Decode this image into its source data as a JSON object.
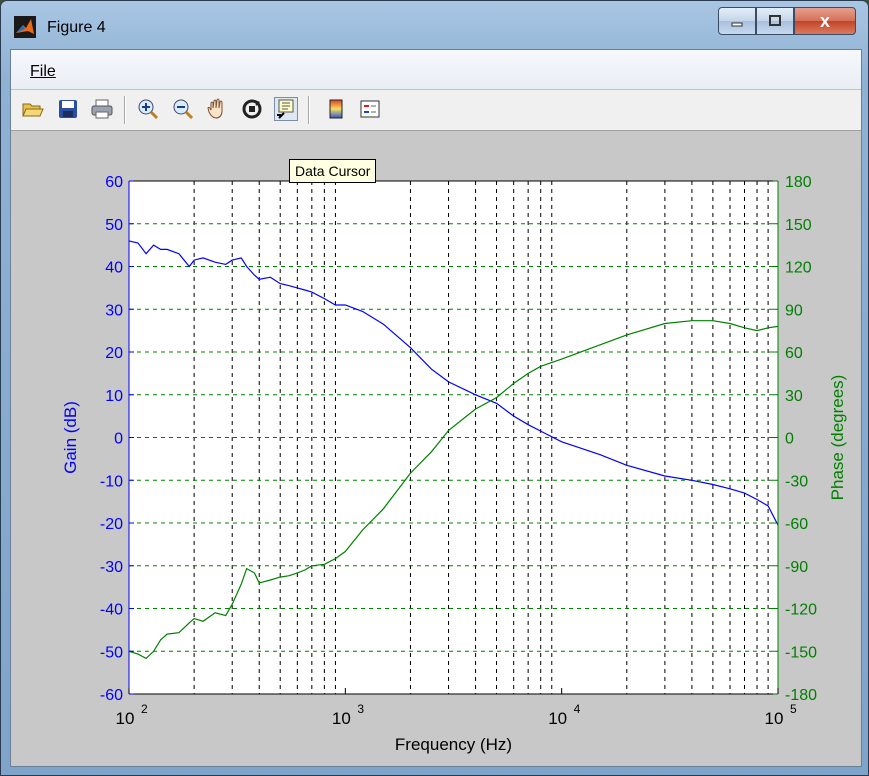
{
  "window": {
    "title": "Figure 4",
    "caption_close": "x"
  },
  "menu": {
    "file": "File"
  },
  "toolbar": {
    "icons": [
      "open-icon",
      "save-icon",
      "print-icon",
      "zoom-in-icon",
      "zoom-out-icon",
      "pan-hand-icon",
      "rotate-3d-icon",
      "data-cursor-icon",
      "colorbar-icon",
      "legend-icon"
    ],
    "active": "data-cursor-icon"
  },
  "tooltip": {
    "text": "Data Cursor"
  },
  "colors": {
    "left_axis": "#0000ff",
    "right_axis": "#008000",
    "grid_x": "#000000",
    "grid_y": "#008000"
  },
  "chart_data": {
    "type": "line",
    "xlabel": "Frequency (Hz)",
    "ylabel_left": "Gain (dB)",
    "ylabel_right": "Phase (degrees)",
    "xscale": "log",
    "xlim": [
      100,
      100000
    ],
    "x_ticks": [
      {
        "base": "10",
        "exp": "2"
      },
      {
        "base": "10",
        "exp": "3"
      },
      {
        "base": "10",
        "exp": "4"
      },
      {
        "base": "10",
        "exp": "5"
      }
    ],
    "ylim_left": [
      -60,
      60
    ],
    "y_ticks_left": [
      "60",
      "50",
      "40",
      "30",
      "20",
      "10",
      "0",
      "-10",
      "-20",
      "-30",
      "-40",
      "-50",
      "-60"
    ],
    "ylim_right": [
      -180,
      180
    ],
    "y_ticks_right": [
      "180",
      "150",
      "120",
      "90",
      "60",
      "30",
      "0",
      "-30",
      "-60",
      "-90",
      "-120",
      "-150",
      "-180"
    ],
    "grid": true,
    "series": [
      {
        "axis": "left",
        "color": "#0000ff",
        "x": [
          100,
          110,
          120,
          130,
          140,
          150,
          170,
          190,
          200,
          220,
          250,
          280,
          300,
          330,
          350,
          380,
          400,
          450,
          500,
          550,
          600,
          650,
          700,
          800,
          900,
          1000,
          1200,
          1500,
          2000,
          2500,
          3000,
          4000,
          5000,
          6000,
          7000,
          8000,
          10000,
          15000,
          20000,
          30000,
          40000,
          50000,
          60000,
          70000,
          80000,
          90000,
          100000
        ],
        "y": [
          46,
          45.5,
          43,
          45,
          44,
          44,
          43,
          40,
          41.5,
          42,
          41,
          40.5,
          41.5,
          42,
          40,
          38,
          37,
          37.5,
          36,
          35.5,
          35,
          34.5,
          34,
          32.5,
          31,
          31,
          29.5,
          26.5,
          21,
          16,
          13,
          10,
          8,
          5,
          3,
          1.5,
          -1,
          -4,
          -6.5,
          -9,
          -10,
          -11,
          -12,
          -13,
          -14.5,
          -16,
          -20.5
        ]
      },
      {
        "axis": "right",
        "color": "#008000",
        "x": [
          100,
          110,
          120,
          130,
          140,
          150,
          170,
          190,
          200,
          220,
          250,
          280,
          300,
          330,
          350,
          380,
          400,
          450,
          500,
          550,
          600,
          650,
          700,
          800,
          900,
          1000,
          1200,
          1500,
          2000,
          2500,
          3000,
          4000,
          5000,
          6000,
          7000,
          8000,
          10000,
          15000,
          20000,
          30000,
          40000,
          50000,
          60000,
          70000,
          80000,
          90000,
          100000
        ],
        "y": [
          -150,
          -152,
          -155,
          -150,
          -142,
          -138,
          -137,
          -130,
          -127,
          -129,
          -123,
          -125,
          -117,
          -103,
          -92,
          -95,
          -102,
          -100,
          -98,
          -97,
          -95,
          -93,
          -90,
          -89,
          -85,
          -80,
          -65,
          -50,
          -25,
          -10,
          5,
          20,
          28,
          38,
          45,
          50,
          55,
          65,
          72,
          80,
          82,
          82,
          80,
          77,
          75,
          77,
          78
        ]
      }
    ]
  }
}
